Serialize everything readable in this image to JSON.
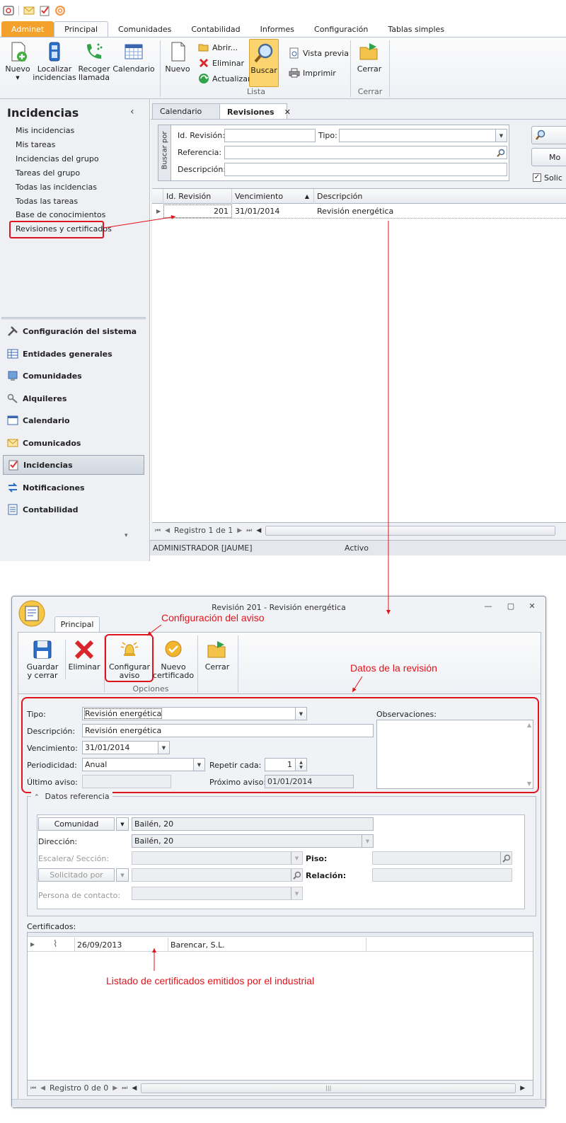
{
  "app": {
    "ribbon_tabs": [
      "Adminet",
      "Principal",
      "Comunidades",
      "Contabilidad",
      "Informes",
      "Configuración",
      "Tablas simples"
    ],
    "ribbon": {
      "nuevo": "Nuevo",
      "localizar": [
        "Localizar",
        "incidencias"
      ],
      "recoger": [
        "Recoger",
        "llamada"
      ],
      "calendario": "Calendario",
      "nuevo2": "Nuevo",
      "abrir": "Abrir...",
      "eliminar": "Eliminar",
      "actualizar": "Actualizar",
      "buscar": "Buscar",
      "vista_previa": "Vista previa",
      "imprimir": "Imprimir",
      "cerrar": "Cerrar",
      "group_lista": "Lista",
      "group_cerrar": "Cerrar"
    },
    "sidebar": {
      "title": "Incidencias",
      "collapse": "‹",
      "links": [
        "Mis incidencias",
        "Mis tareas",
        "Incidencias del grupo",
        "Tareas del grupo",
        "Todas las incidencias",
        "Todas las tareas",
        "Base de conocimientos",
        "Revisiones y certificados"
      ],
      "modules": [
        "Configuración del sistema",
        "Entidades generales",
        "Comunidades",
        "Alquileres",
        "Calendario",
        "Comunicados",
        "Incidencias",
        "Notificaciones",
        "Contabilidad"
      ],
      "more": "▾"
    },
    "doc_tabs": [
      "Calendario",
      "Revisiones"
    ],
    "close_x": "✕",
    "search": {
      "vertical": "Buscar por",
      "id_label": "Id. Revisión:",
      "tipo_label": "Tipo:",
      "ref_label": "Referencia:",
      "desc_label": "Descripción:",
      "more_btn": "Mo",
      "check_label": "Solic"
    },
    "grid": {
      "columns": [
        "Id. Revisión",
        "Vencimiento",
        "Descripción"
      ],
      "rows": [
        {
          "id": "201",
          "venc": "31/01/2014",
          "desc": "Revisión energética"
        }
      ],
      "nav": "Registro 1 de 1"
    },
    "status": {
      "user": "ADMINISTRADOR [JAUME]",
      "state": "Activo"
    }
  },
  "dialog": {
    "title": "Revisión 201 - Revisión energética",
    "tab": "Principal",
    "buttons": {
      "guardar": [
        "Guardar",
        "y cerrar"
      ],
      "eliminar": "Eliminar",
      "configurar": [
        "Configurar",
        "aviso"
      ],
      "nuevo_cert": [
        "Nuevo",
        "certificado"
      ],
      "cerrar": "Cerrar",
      "group_opciones": "Opciones"
    },
    "form": {
      "tipo_label": "Tipo:",
      "tipo": "Revisión energética",
      "desc_label": "Descripción:",
      "desc": "Revisión energética",
      "venc_label": "Vencimiento:",
      "venc": "31/01/2014",
      "period_label": "Periodicidad:",
      "period": "Anual",
      "repetir_label": "Repetir cada:",
      "repetir": "1",
      "ultimo_label": "Último aviso:",
      "ultimo": "",
      "proximo_label": "Próximo aviso:",
      "proximo": "01/01/2014",
      "obs_label": "Observaciones:"
    },
    "ref": {
      "section": "Datos referencia",
      "comunidad_btn": "Comunidad",
      "comunidad": "Bailén, 20",
      "direccion_label": "Dirección:",
      "direccion": "Bailén, 20",
      "escalera_label": "Escalera/ Sección:",
      "piso_label": "Piso:",
      "solicitado_btn": "Solicitado por",
      "relacion_label": "Relación:",
      "contacto_label": "Persona de contacto:"
    },
    "certs": {
      "label": "Certificados:",
      "rows": [
        {
          "fecha": "26/09/2013",
          "empresa": "Barencar, S.L."
        }
      ],
      "nav": "Registro 0 de 0",
      "scroll": "|||"
    }
  },
  "annotations": {
    "configuracion": "Configuración del aviso",
    "datos": "Datos de la revisión",
    "listado": "Listado de certificados emitidos por el industrial"
  },
  "colors": {
    "accent": "#f4a12b",
    "annotation": "#e0141c",
    "selected": "#fbd470"
  }
}
